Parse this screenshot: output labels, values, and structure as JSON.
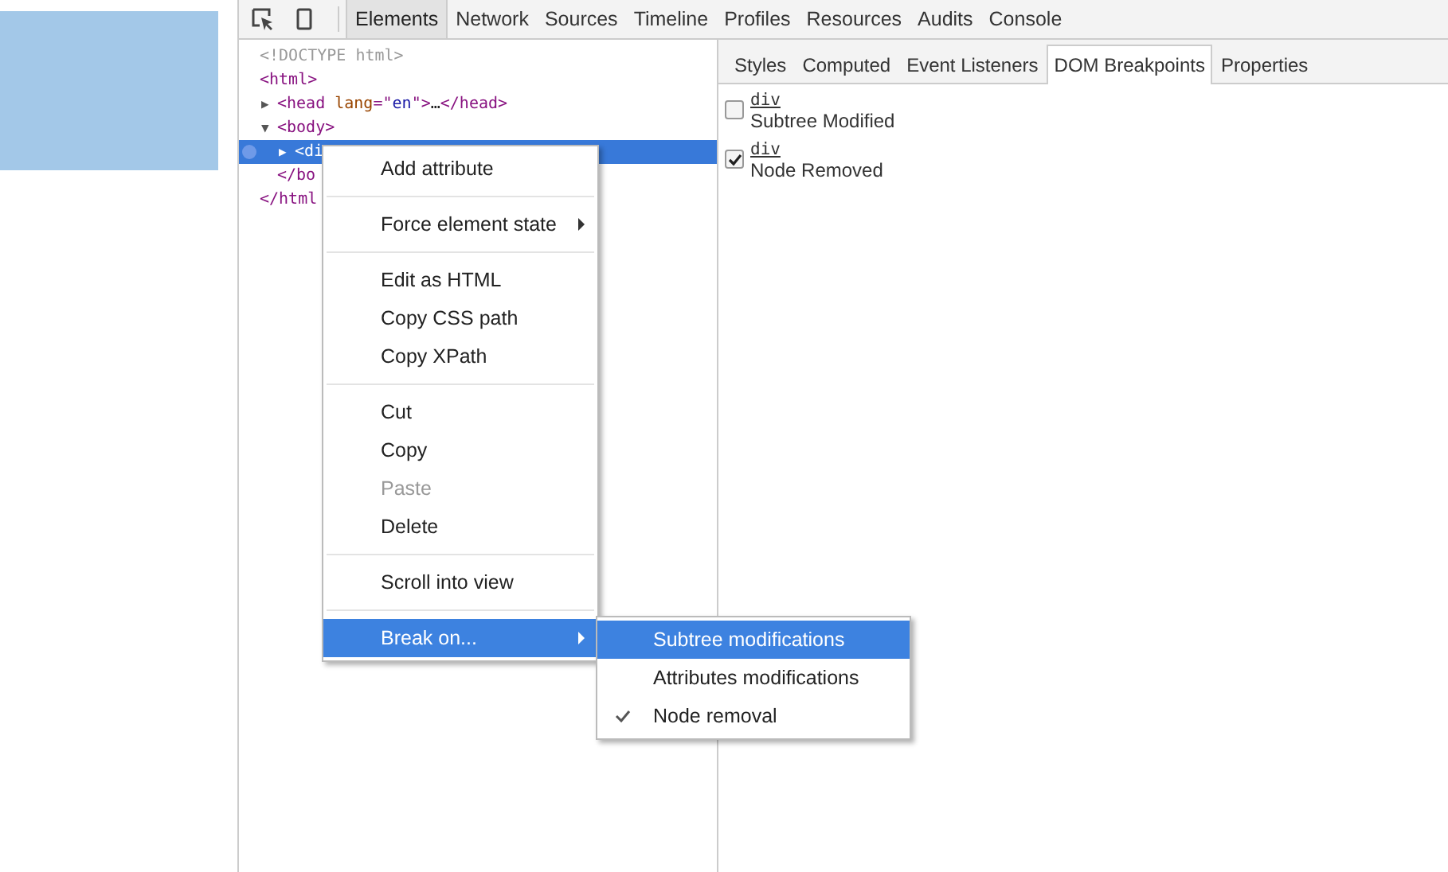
{
  "toolbar": {
    "tabs": [
      {
        "label": "Elements",
        "selected": true
      },
      {
        "label": "Network",
        "selected": false
      },
      {
        "label": "Sources",
        "selected": false
      },
      {
        "label": "Timeline",
        "selected": false
      },
      {
        "label": "Profiles",
        "selected": false
      },
      {
        "label": "Resources",
        "selected": false
      },
      {
        "label": "Audits",
        "selected": false
      },
      {
        "label": "Console",
        "selected": false
      }
    ]
  },
  "dom_tree": {
    "lines": [
      {
        "selected": false,
        "parts": [
          {
            "kind": "doctype",
            "text": "<!DOCTYPE html>"
          }
        ]
      },
      {
        "selected": false,
        "parts": [
          {
            "kind": "tag",
            "text": "<html>"
          }
        ],
        "children": [
          {
            "toggle": "▶",
            "selected": false,
            "parts": [
              {
                "kind": "tag",
                "text": "<head "
              },
              {
                "kind": "attr",
                "text": "lang"
              },
              {
                "kind": "tag",
                "text": "=\""
              },
              {
                "kind": "value",
                "text": "en"
              },
              {
                "kind": "tag",
                "text": "\">"
              },
              {
                "kind": "plain",
                "text": "…"
              },
              {
                "kind": "tag",
                "text": "</head>"
              }
            ]
          },
          {
            "toggle": "▼",
            "selected": false,
            "parts": [
              {
                "kind": "tag",
                "text": "<body>"
              }
            ],
            "children": [
              {
                "toggle": "▶",
                "selected": true,
                "parts": [
                  {
                    "kind": "tag",
                    "text": "<di"
                  }
                ]
              }
            ]
          },
          {
            "selected": false,
            "parts": [
              {
                "kind": "tag",
                "text": "</bo"
              }
            ]
          }
        ]
      },
      {
        "selected": false,
        "parts": [
          {
            "kind": "tag",
            "text": "</html"
          }
        ]
      }
    ]
  },
  "sidebar": {
    "tabs": [
      {
        "label": "Styles",
        "selected": false
      },
      {
        "label": "Computed",
        "selected": false
      },
      {
        "label": "Event Listeners",
        "selected": false
      },
      {
        "label": "DOM Breakpoints",
        "selected": true
      },
      {
        "label": "Properties",
        "selected": false
      }
    ],
    "breakpoints": [
      {
        "node": "div",
        "label": "Subtree Modified",
        "checked": false
      },
      {
        "node": "div",
        "label": "Node Removed",
        "checked": true
      }
    ]
  },
  "context_menu": {
    "items": [
      {
        "kind": "item",
        "label": "Add attribute",
        "disabled": false,
        "has_submenu": false,
        "selected": false
      },
      {
        "kind": "separator"
      },
      {
        "kind": "item",
        "label": "Force element state",
        "disabled": false,
        "has_submenu": true,
        "selected": false
      },
      {
        "kind": "separator"
      },
      {
        "kind": "item",
        "label": "Edit as HTML",
        "disabled": false,
        "has_submenu": false,
        "selected": false
      },
      {
        "kind": "item",
        "label": "Copy CSS path",
        "disabled": false,
        "has_submenu": false,
        "selected": false
      },
      {
        "kind": "item",
        "label": "Copy XPath",
        "disabled": false,
        "has_submenu": false,
        "selected": false
      },
      {
        "kind": "separator"
      },
      {
        "kind": "item",
        "label": "Cut",
        "disabled": false,
        "has_submenu": false,
        "selected": false
      },
      {
        "kind": "item",
        "label": "Copy",
        "disabled": false,
        "has_submenu": false,
        "selected": false
      },
      {
        "kind": "item",
        "label": "Paste",
        "disabled": true,
        "has_submenu": false,
        "selected": false
      },
      {
        "kind": "item",
        "label": "Delete",
        "disabled": false,
        "has_submenu": false,
        "selected": false
      },
      {
        "kind": "separator"
      },
      {
        "kind": "item",
        "label": "Scroll into view",
        "disabled": false,
        "has_submenu": false,
        "selected": false
      },
      {
        "kind": "separator"
      },
      {
        "kind": "item",
        "label": "Break on...",
        "disabled": false,
        "has_submenu": true,
        "selected": true
      }
    ]
  },
  "submenu": {
    "items": [
      {
        "label": "Subtree modifications",
        "checked": false,
        "selected": true
      },
      {
        "label": "Attributes modifications",
        "checked": false,
        "selected": false
      },
      {
        "label": "Node removal",
        "checked": true,
        "selected": false
      }
    ]
  }
}
